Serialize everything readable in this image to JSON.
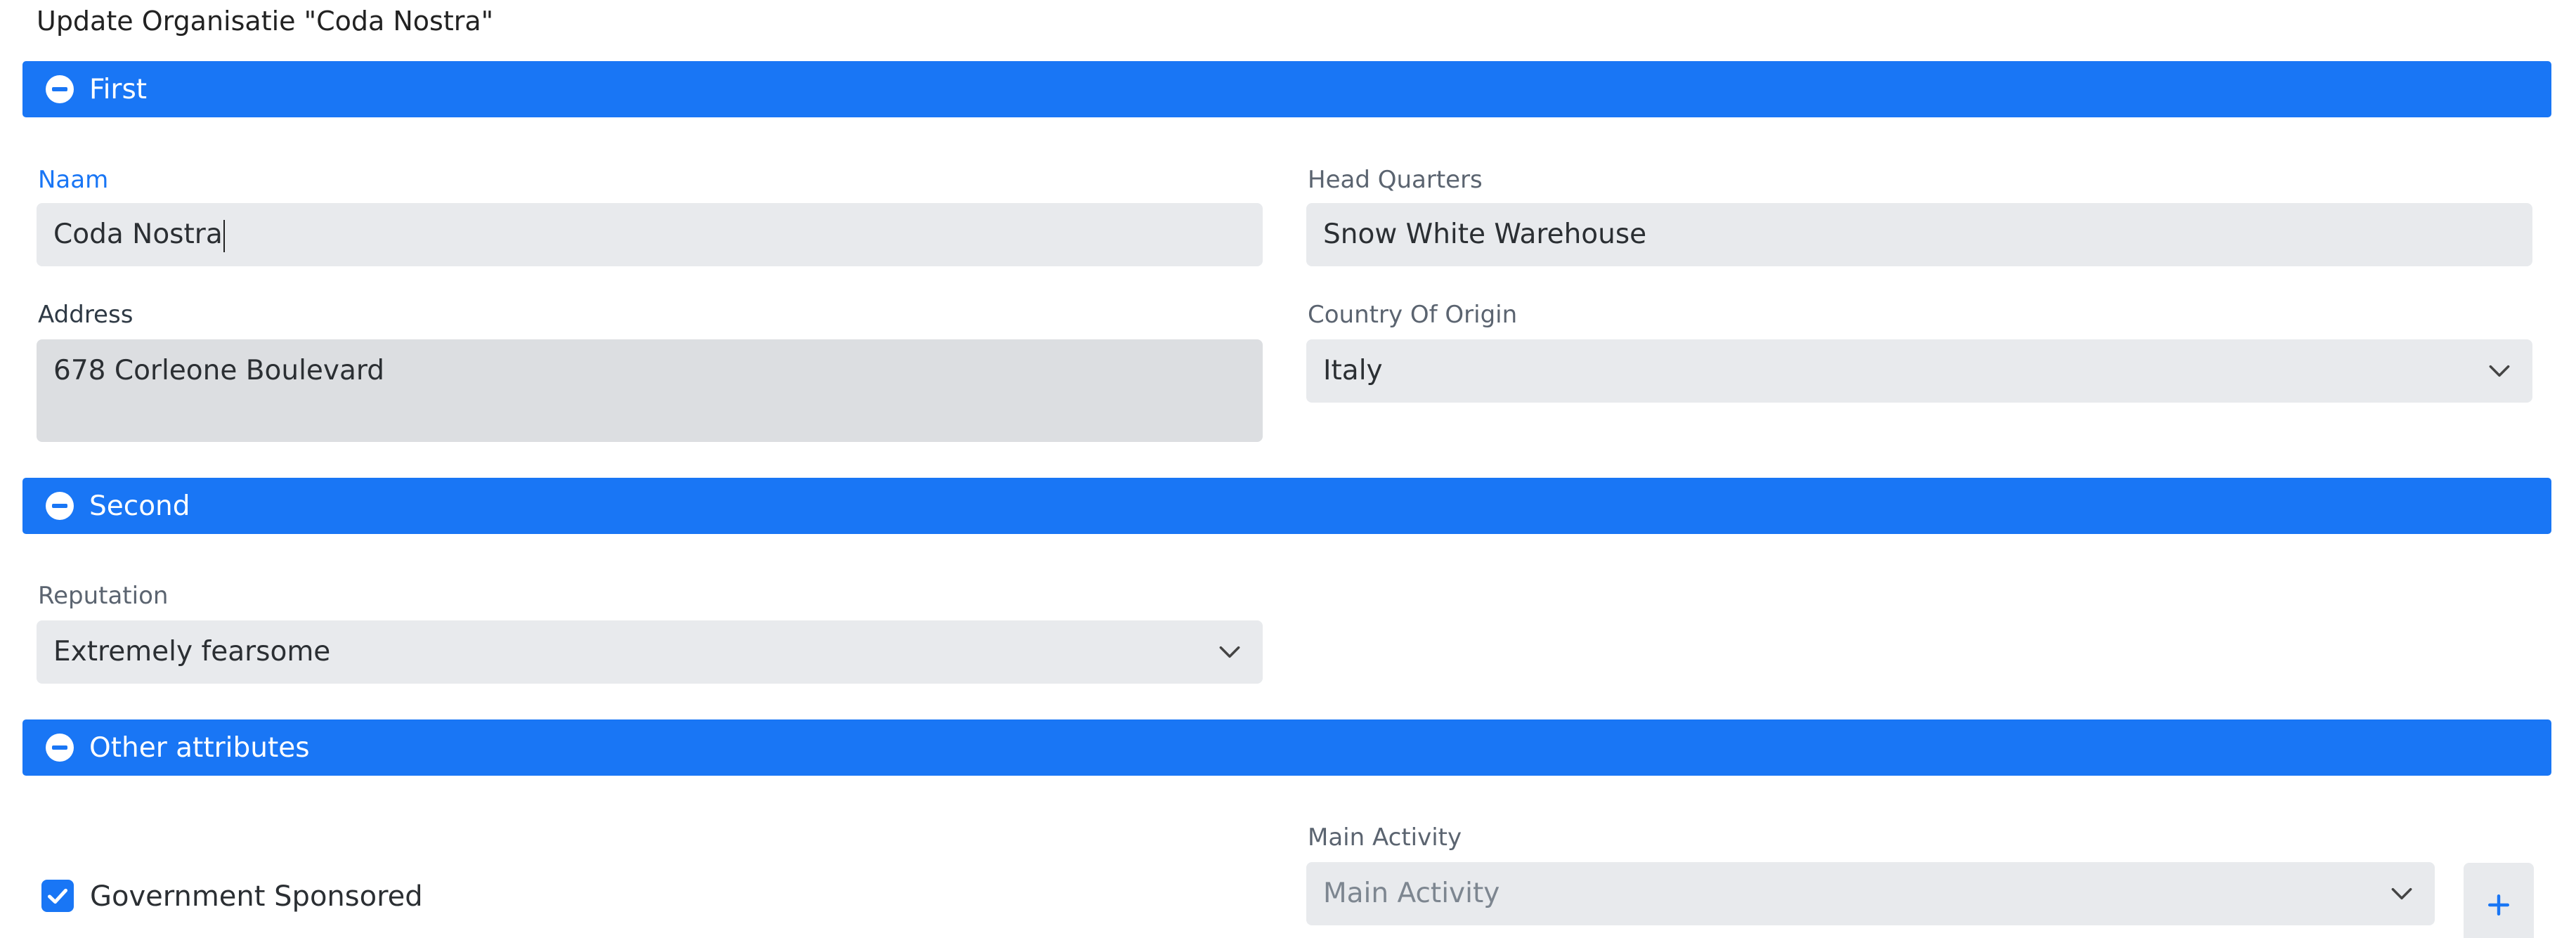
{
  "page": {
    "title": "Update Organisatie \"Coda Nostra\""
  },
  "colors": {
    "accent": "#1976f5",
    "field_bg": "#e8eaed"
  },
  "sections": [
    {
      "label": "First"
    },
    {
      "label": "Second"
    },
    {
      "label": "Other attributes"
    }
  ],
  "fields": {
    "naam": {
      "label": "Naam",
      "value": "Coda Nostra"
    },
    "head_quarters": {
      "label": "Head Quarters",
      "value": "Snow White Warehouse"
    },
    "address": {
      "label": "Address",
      "value": "678 Corleone Boulevard"
    },
    "country_of_origin": {
      "label": "Country Of Origin",
      "value": "Italy"
    },
    "reputation": {
      "label": "Reputation",
      "value": "Extremely fearsome"
    },
    "government_sponsored": {
      "label": "Government Sponsored",
      "checked": true
    },
    "main_activity": {
      "label": "Main Activity",
      "placeholder": "Main Activity"
    }
  },
  "icons": [
    "minus-circle-icon",
    "chevron-down-icon",
    "check-icon",
    "plus-icon"
  ]
}
